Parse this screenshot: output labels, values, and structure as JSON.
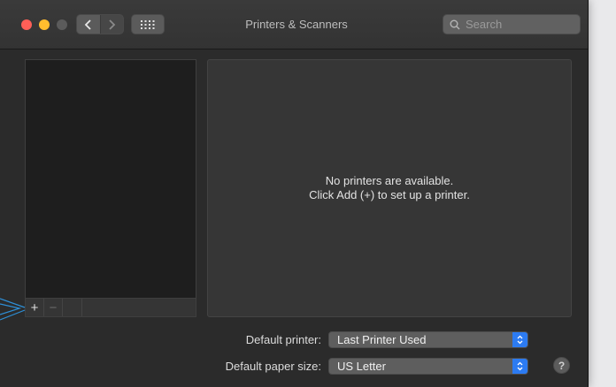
{
  "window": {
    "title": "Printers & Scanners"
  },
  "toolbar": {
    "search_placeholder": "Search",
    "back_icon": "chevron-left-icon",
    "forward_icon": "chevron-right-icon",
    "grid_icon": "grid-icon"
  },
  "printer_list": {
    "add_label": "+",
    "remove_label": "−"
  },
  "detail": {
    "empty_line1": "No printers are available.",
    "empty_line2": "Click Add (+) to set up a printer."
  },
  "defaults": {
    "printer_label": "Default printer:",
    "printer_value": "Last Printer Used",
    "paper_label": "Default paper size:",
    "paper_value": "US Letter"
  },
  "help": {
    "label": "?"
  },
  "colors": {
    "accent": "#2c7bf2",
    "callout": "#2e8fd6"
  }
}
